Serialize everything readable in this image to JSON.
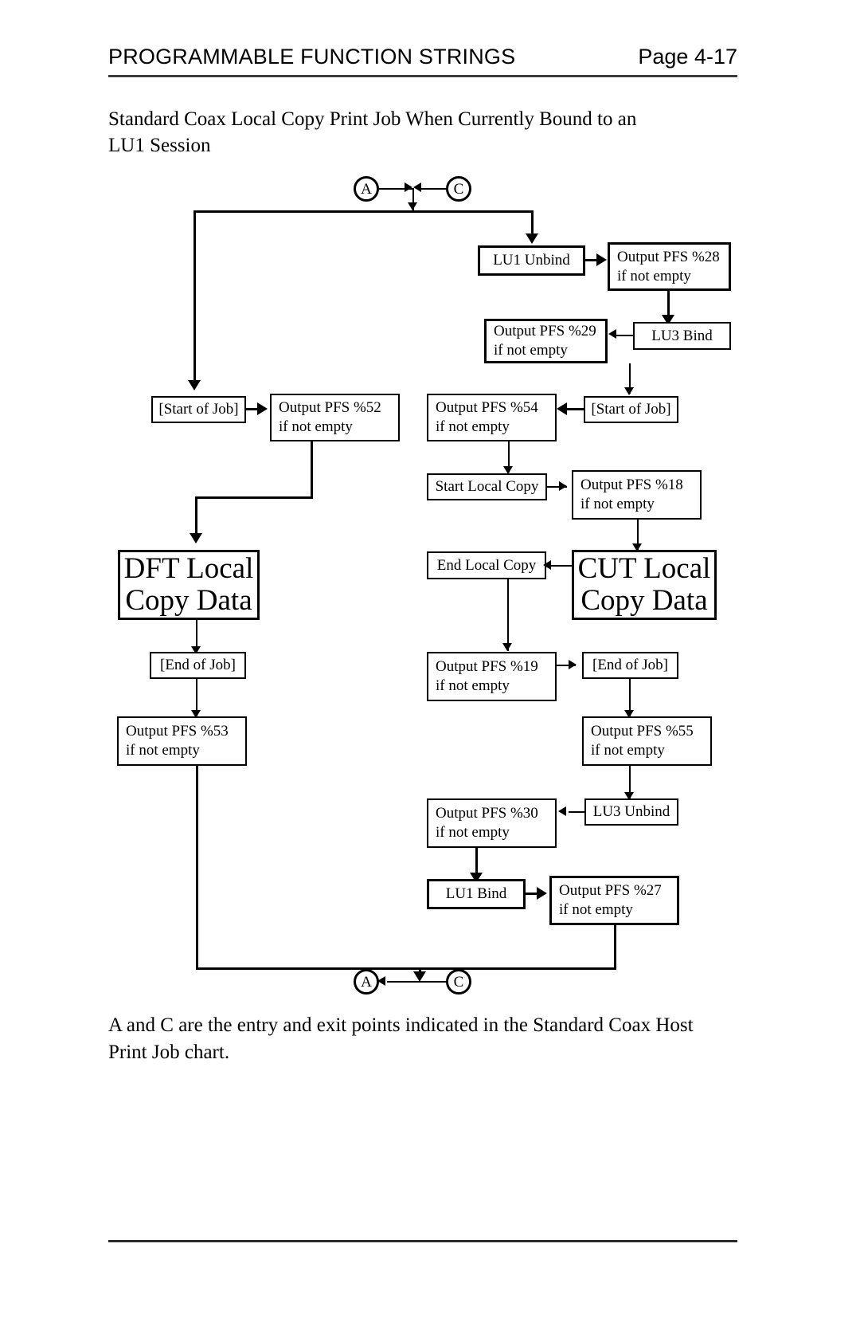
{
  "header": {
    "title": "PROGRAMMABLE FUNCTION STRINGS",
    "page": "Page 4-17"
  },
  "intro": {
    "line1": "Standard Coax Local Copy Print Job When Currently Bound to an",
    "line2": "LU1 Session"
  },
  "caption": {
    "line1": "A and C are the entry and exit points indicated in the Standard Coax Host",
    "line2": "Print Job chart."
  },
  "chart_data": {
    "type": "diagram",
    "title": "Standard Coax Local Copy Print Job When Currently Bound to an LU1 Session",
    "connectors": {
      "entry_a": "A",
      "entry_c": "C",
      "exit_a": "A",
      "exit_c": "C"
    },
    "nodes": [
      {
        "id": "n_lu1_unbind",
        "label": "LU1 Unbind"
      },
      {
        "id": "n_pfs28",
        "label": "Output PFS %28",
        "label2": "if not empty"
      },
      {
        "id": "n_lu3_bind",
        "label": "LU3 Bind"
      },
      {
        "id": "n_pfs29",
        "label": "Output PFS %29",
        "label2": "if not empty"
      },
      {
        "id": "n_start_job_l",
        "label": "[Start of Job]"
      },
      {
        "id": "n_pfs52",
        "label": "Output PFS %52",
        "label2": "if not empty"
      },
      {
        "id": "n_pfs54",
        "label": "Output PFS %54",
        "label2": "if not empty"
      },
      {
        "id": "n_start_job_r",
        "label": "[Start of Job]"
      },
      {
        "id": "n_start_lc",
        "label": "Start Local Copy"
      },
      {
        "id": "n_pfs18",
        "label": "Output PFS %18",
        "label2": "if not empty"
      },
      {
        "id": "n_dft",
        "label": "DFT Local",
        "label2": "Copy Data"
      },
      {
        "id": "n_end_lc",
        "label": "End Local Copy"
      },
      {
        "id": "n_cut",
        "label": "CUT Local",
        "label2": "Copy Data"
      },
      {
        "id": "n_end_job_l",
        "label": "[End of Job]"
      },
      {
        "id": "n_pfs19",
        "label": "Output PFS %19",
        "label2": "if not empty"
      },
      {
        "id": "n_end_job_r",
        "label": "[End of Job]"
      },
      {
        "id": "n_pfs53",
        "label": "Output PFS %53",
        "label2": "if not empty"
      },
      {
        "id": "n_pfs55",
        "label": "Output PFS %55",
        "label2": "if not empty"
      },
      {
        "id": "n_pfs30",
        "label": "Output PFS %30",
        "label2": "if not empty"
      },
      {
        "id": "n_lu3_unbind",
        "label": "LU3 Unbind"
      },
      {
        "id": "n_lu1_bind",
        "label": "LU1 Bind"
      },
      {
        "id": "n_pfs27",
        "label": "Output PFS %27",
        "label2": "if not empty"
      }
    ],
    "edges": [
      {
        "from": "A",
        "to": "junction_top"
      },
      {
        "from": "C",
        "to": "junction_top"
      },
      {
        "from": "junction_top",
        "to": "n_lu1_unbind"
      },
      {
        "from": "junction_top",
        "to": "n_start_job_l"
      },
      {
        "from": "n_lu1_unbind",
        "to": "n_pfs28"
      },
      {
        "from": "n_pfs28",
        "to": "n_lu3_bind"
      },
      {
        "from": "n_lu3_bind",
        "to": "n_pfs29"
      },
      {
        "from": "n_pfs29",
        "to": "n_start_job_r"
      },
      {
        "from": "n_start_job_l",
        "to": "n_pfs52"
      },
      {
        "from": "n_start_job_r",
        "to": "n_pfs54"
      },
      {
        "from": "n_pfs52",
        "to": "n_dft"
      },
      {
        "from": "n_pfs54",
        "to": "n_start_lc"
      },
      {
        "from": "n_start_lc",
        "to": "n_pfs18"
      },
      {
        "from": "n_pfs18",
        "to": "n_cut"
      },
      {
        "from": "n_cut",
        "to": "n_end_lc"
      },
      {
        "from": "n_dft",
        "to": "n_end_job_l"
      },
      {
        "from": "n_end_lc",
        "to": "n_pfs19"
      },
      {
        "from": "n_pfs19",
        "to": "n_end_job_r"
      },
      {
        "from": "n_end_job_l",
        "to": "n_pfs53"
      },
      {
        "from": "n_end_job_r",
        "to": "n_pfs55"
      },
      {
        "from": "n_pfs55",
        "to": "n_lu3_unbind"
      },
      {
        "from": "n_lu3_unbind",
        "to": "n_pfs30"
      },
      {
        "from": "n_pfs30",
        "to": "n_lu1_bind"
      },
      {
        "from": "n_lu1_bind",
        "to": "n_pfs27"
      },
      {
        "from": "n_pfs53",
        "to": "exit_A"
      },
      {
        "from": "n_pfs27",
        "to": "exit_C"
      },
      {
        "from": "exit_C",
        "to": "exit_A"
      }
    ]
  }
}
